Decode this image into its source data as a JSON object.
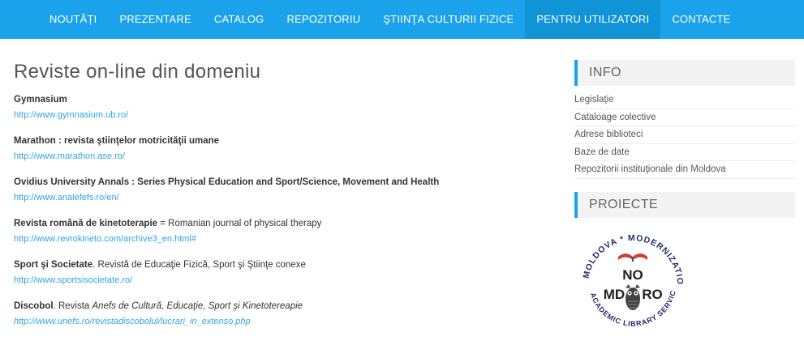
{
  "nav": {
    "items": [
      "NOUTĂȚI",
      "PREZENTARE",
      "CATALOG",
      "REPOZITORIU",
      "ŞTIINŢA CULTURII FIZICE",
      "PENTRU UTILIZATORI",
      "CONTACTE"
    ],
    "active_index": 5
  },
  "main": {
    "title": "Reviste on-line din domeniu",
    "entries": [
      {
        "name_bold": "Gymnasium",
        "name_rest": "",
        "url": "http://www.gymnasium.ub.ro/"
      },
      {
        "name_bold": "Marathon : revista ştiinţelor motricităţii umane",
        "name_rest": "",
        "url": "http://www.marathon.ase.ro/"
      },
      {
        "name_bold": "Ovidius University Annals : Series Physical Education and Sport/Science, Movement and Health",
        "name_rest": "",
        "url": "http://www.analefefs.ro/en/"
      },
      {
        "name_bold": "Revista română de kinetoterapie",
        "name_rest": " = Romanian journal of physical therapy",
        "url": "http://www.revrokineto.com/archive3_en.html#"
      },
      {
        "name_bold": "Sport şi Societate",
        "name_rest": ". Revistă de Educaţie Fizică, Sport şi Ştiinţe conexe",
        "url": "http://www.sportsisocietate.ro/"
      },
      {
        "name_bold": "Discobol",
        "name_rest": ". Revista ",
        "name_italic": "Anefs de Cultură, Educaţie, Sport şi Kinetotereapie",
        "url": "http://www.unefs.ro/revistadiscobolul/lucrari_in_extenso.php"
      }
    ]
  },
  "sidebar": {
    "info_title": "INFO",
    "info_items": [
      "Legislaţie",
      "Cataloage colective",
      "Adrese biblioteci",
      "Baze de date",
      "Repozitorii instituţionale din Moldova"
    ],
    "projects_title": "PROIECTE",
    "logo": {
      "ring_text": "IN MOLDOVA * MODERNIZATION OF ACADEMIC LIBRARY SERVICES",
      "line1": "NO",
      "line2_left": "MD",
      "line2_right": "RO"
    }
  }
}
